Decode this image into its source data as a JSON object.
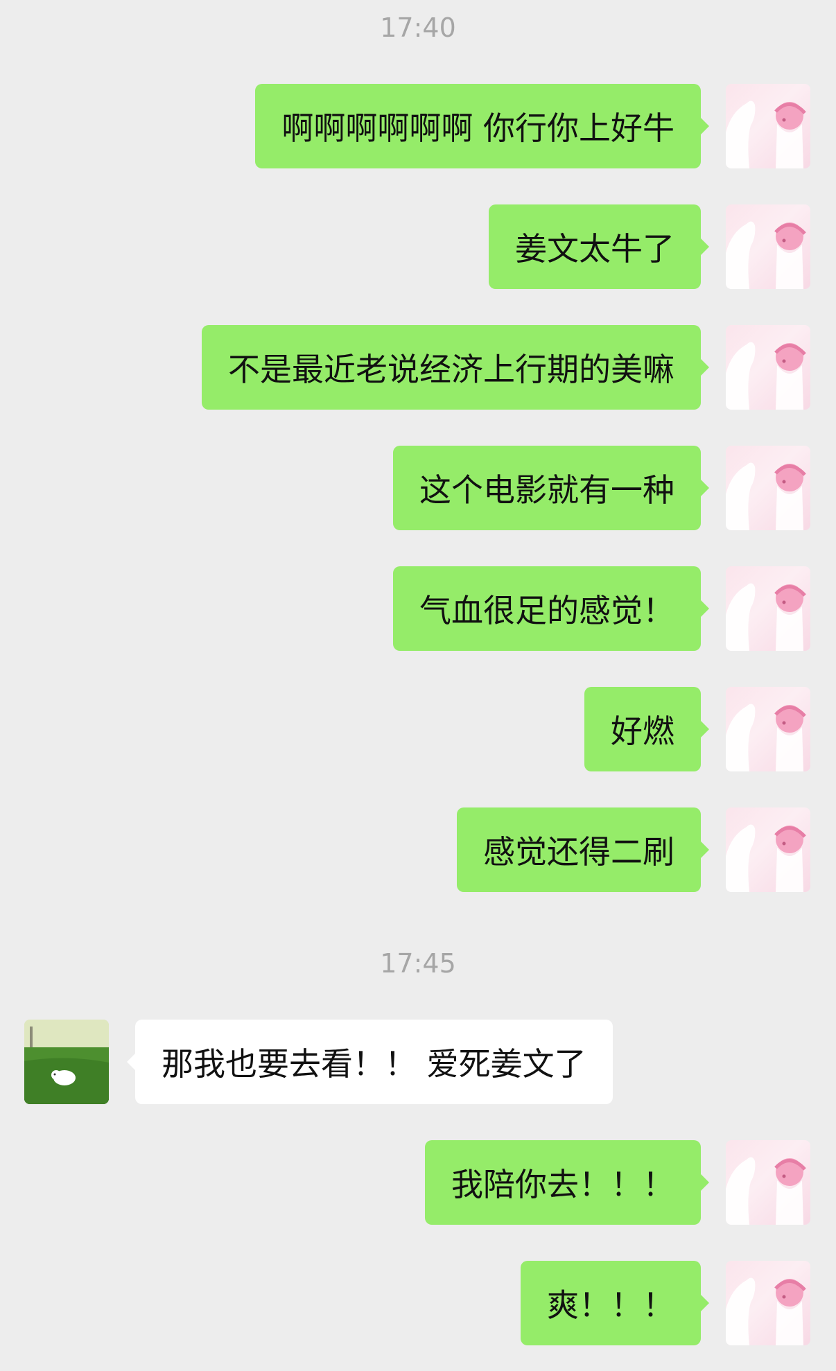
{
  "chat": {
    "groups": [
      {
        "time": "17:40",
        "messages": [
          {
            "from": "me",
            "text": "啊啊啊啊啊啊 你行你上好牛"
          },
          {
            "from": "me",
            "text": "姜文太牛了"
          },
          {
            "from": "me",
            "text": "不是最近老说经济上行期的美嘛"
          },
          {
            "from": "me",
            "text": "这个电影就有一种"
          },
          {
            "from": "me",
            "text": "气血很足的感觉！"
          },
          {
            "from": "me",
            "text": "好燃"
          },
          {
            "from": "me",
            "text": "感觉还得二刷"
          }
        ]
      },
      {
        "time": "17:45",
        "messages": [
          {
            "from": "friend",
            "text": "那我也要去看！！ 爱死姜文了"
          },
          {
            "from": "me",
            "text": "我陪你去！！！"
          },
          {
            "from": "me",
            "text": "爽！！！"
          }
        ]
      }
    ]
  },
  "avatars": {
    "me": {
      "icon": "anime-girl-with-white-cat-avatar-icon"
    },
    "friend": {
      "icon": "white-puppy-on-grass-avatar-icon"
    }
  },
  "colors": {
    "background": "#ededed",
    "sent_bubble": "#95ec69",
    "received_bubble": "#ffffff",
    "timestamp_text": "#a6a6a6"
  }
}
